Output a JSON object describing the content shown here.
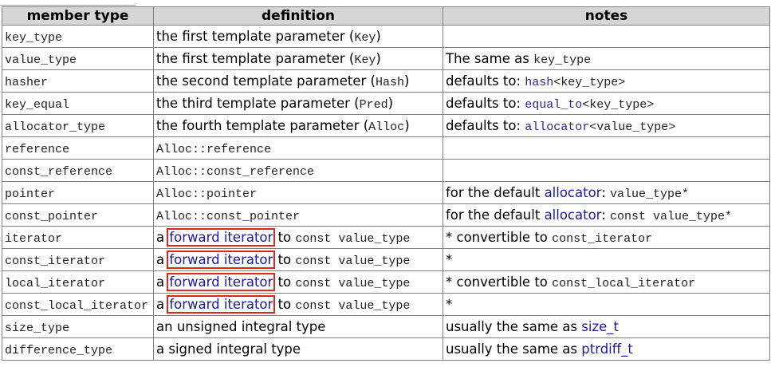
{
  "table": {
    "headers": [
      "member type",
      "definition",
      "notes"
    ],
    "rows": [
      {
        "member": "key_type",
        "definition": [
          {
            "t": "the first template parameter ("
          },
          {
            "t": "Key",
            "mono": true
          },
          {
            "t": ")"
          }
        ],
        "notes": []
      },
      {
        "member": "value_type",
        "definition": [
          {
            "t": "the first template parameter ("
          },
          {
            "t": "Key",
            "mono": true
          },
          {
            "t": ")"
          }
        ],
        "notes": [
          {
            "t": "The same as "
          },
          {
            "t": "key_type",
            "mono": true
          }
        ]
      },
      {
        "member": "hasher",
        "definition": [
          {
            "t": "the second template parameter ("
          },
          {
            "t": "Hash",
            "mono": true
          },
          {
            "t": ")"
          }
        ],
        "notes": [
          {
            "t": "defaults to: "
          },
          {
            "t": "hash",
            "mono": true,
            "link": true
          },
          {
            "t": "<key_type>",
            "mono": true
          }
        ]
      },
      {
        "member": "key_equal",
        "definition": [
          {
            "t": "the third template parameter ("
          },
          {
            "t": "Pred",
            "mono": true
          },
          {
            "t": ")"
          }
        ],
        "notes": [
          {
            "t": "defaults to: "
          },
          {
            "t": "equal_to",
            "mono": true,
            "link": true
          },
          {
            "t": "<key_type>",
            "mono": true
          }
        ]
      },
      {
        "member": "allocator_type",
        "definition": [
          {
            "t": "the fourth template parameter ("
          },
          {
            "t": "Alloc",
            "mono": true
          },
          {
            "t": ")"
          }
        ],
        "notes": [
          {
            "t": "defaults to: "
          },
          {
            "t": "allocator",
            "mono": true,
            "link": true
          },
          {
            "t": "<value_type>",
            "mono": true
          }
        ]
      },
      {
        "member": "reference",
        "definition": [
          {
            "t": "Alloc::reference",
            "mono": true
          }
        ],
        "notes": []
      },
      {
        "member": "const_reference",
        "definition": [
          {
            "t": "Alloc::const_reference",
            "mono": true
          }
        ],
        "notes": []
      },
      {
        "member": "pointer",
        "definition": [
          {
            "t": "Alloc::pointer",
            "mono": true
          }
        ],
        "notes": [
          {
            "t": "for the default "
          },
          {
            "t": "allocator",
            "link": true
          },
          {
            "t": ": "
          },
          {
            "t": "value_type*",
            "mono": true
          }
        ]
      },
      {
        "member": "const_pointer",
        "definition": [
          {
            "t": "Alloc::const_pointer",
            "mono": true
          }
        ],
        "notes": [
          {
            "t": "for the default "
          },
          {
            "t": "allocator",
            "link": true
          },
          {
            "t": ": "
          },
          {
            "t": "const value_type*",
            "mono": true
          }
        ]
      },
      {
        "member": "iterator",
        "definition": [
          {
            "t": "a "
          },
          {
            "t": "forward iterator",
            "link": true,
            "hl": true
          },
          {
            "t": " to "
          },
          {
            "t": "const value_type",
            "mono": true
          }
        ],
        "notes": [
          {
            "t": "* convertible to "
          },
          {
            "t": "const_iterator",
            "mono": true
          }
        ]
      },
      {
        "member": "const_iterator",
        "definition": [
          {
            "t": "a "
          },
          {
            "t": "forward iterator",
            "link": true,
            "hl": true
          },
          {
            "t": " to "
          },
          {
            "t": "const value_type",
            "mono": true
          }
        ],
        "notes": [
          {
            "t": "*"
          }
        ]
      },
      {
        "member": "local_iterator",
        "definition": [
          {
            "t": "a "
          },
          {
            "t": "forward iterator",
            "link": true,
            "hl": true
          },
          {
            "t": " to "
          },
          {
            "t": "const value_type",
            "mono": true
          }
        ],
        "notes": [
          {
            "t": "* convertible to "
          },
          {
            "t": "const_local_iterator",
            "mono": true
          }
        ]
      },
      {
        "member": "const_local_iterator",
        "definition": [
          {
            "t": "a "
          },
          {
            "t": "forward iterator",
            "link": true,
            "hl": true
          },
          {
            "t": " to "
          },
          {
            "t": "const value_type",
            "mono": true
          }
        ],
        "notes": [
          {
            "t": "*"
          }
        ]
      },
      {
        "member": "size_type",
        "definition": [
          {
            "t": "an unsigned integral type"
          }
        ],
        "notes": [
          {
            "t": "usually the same as "
          },
          {
            "t": "size_t",
            "link": true
          }
        ]
      },
      {
        "member": "difference_type",
        "definition": [
          {
            "t": "a signed integral type"
          }
        ],
        "notes": [
          {
            "t": "usually the same as "
          },
          {
            "t": "ptrdiff_t",
            "link": true
          }
        ]
      }
    ]
  },
  "colors": {
    "header_bg": "#d6d6d6",
    "border": "#7f7f7f",
    "link": "#1a1a9a",
    "highlight_box": "#d9281d"
  }
}
